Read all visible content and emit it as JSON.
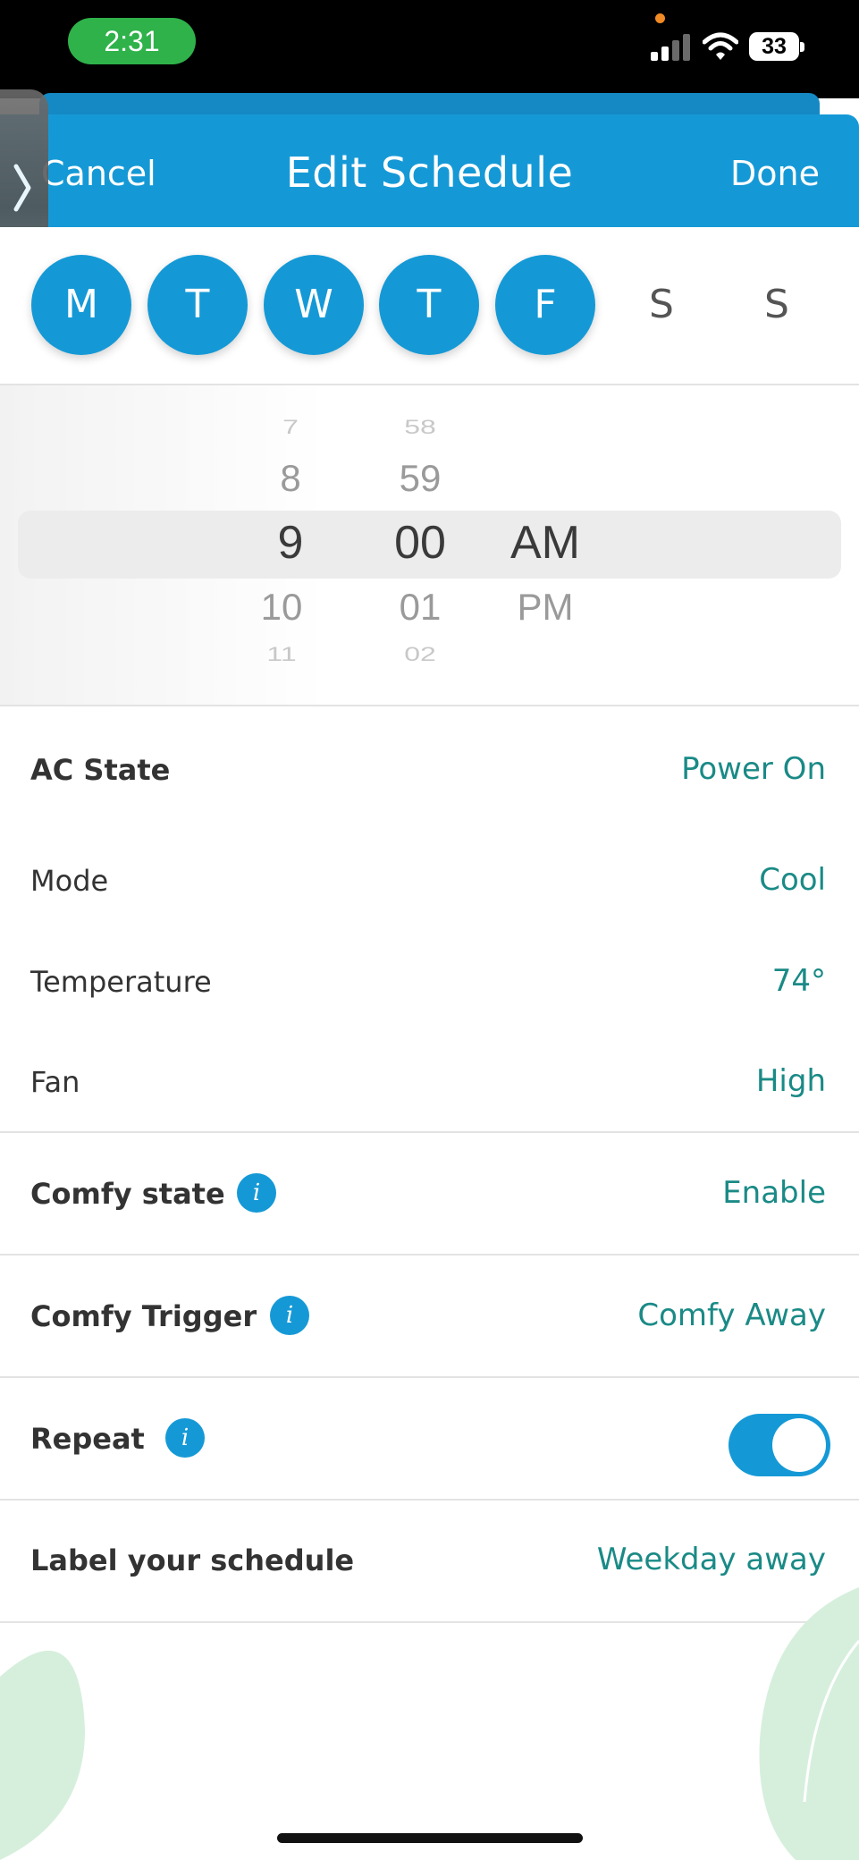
{
  "status_bar": {
    "time": "2:31",
    "battery": "33"
  },
  "header": {
    "cancel_label": "Cancel",
    "title": "Edit Schedule",
    "done_label": "Done"
  },
  "days": [
    {
      "label": "M",
      "selected": true
    },
    {
      "label": "T",
      "selected": true
    },
    {
      "label": "W",
      "selected": true
    },
    {
      "label": "T",
      "selected": true
    },
    {
      "label": "F",
      "selected": true
    },
    {
      "label": "S",
      "selected": false
    },
    {
      "label": "S",
      "selected": false
    }
  ],
  "time_picker": {
    "hour": {
      "far_before": "7",
      "before": "8",
      "selected": "9",
      "after": "10",
      "far_after": "11"
    },
    "minute": {
      "far_before": "58",
      "before": "59",
      "selected": "00",
      "after": "01",
      "far_after": "02"
    },
    "period": {
      "selected": "AM",
      "after": "PM"
    }
  },
  "settings": {
    "ac_state": {
      "label": "AC State",
      "value": "Power On"
    },
    "mode": {
      "label": "Mode",
      "value": "Cool"
    },
    "temperature": {
      "label": "Temperature",
      "value": "74°"
    },
    "fan": {
      "label": "Fan",
      "value": "High"
    },
    "comfy_state": {
      "label": "Comfy state",
      "value": "Enable"
    },
    "comfy_trigger": {
      "label": "Comfy Trigger",
      "value": "Comfy Away"
    },
    "repeat": {
      "label": "Repeat",
      "enabled": true
    },
    "schedule_label": {
      "label": "Label your schedule",
      "value": "Weekday away"
    }
  },
  "info_glyph": "i",
  "colors": {
    "accent": "#1599d6",
    "value_text": "#1a8a86",
    "status_pill": "#2fb24a"
  }
}
